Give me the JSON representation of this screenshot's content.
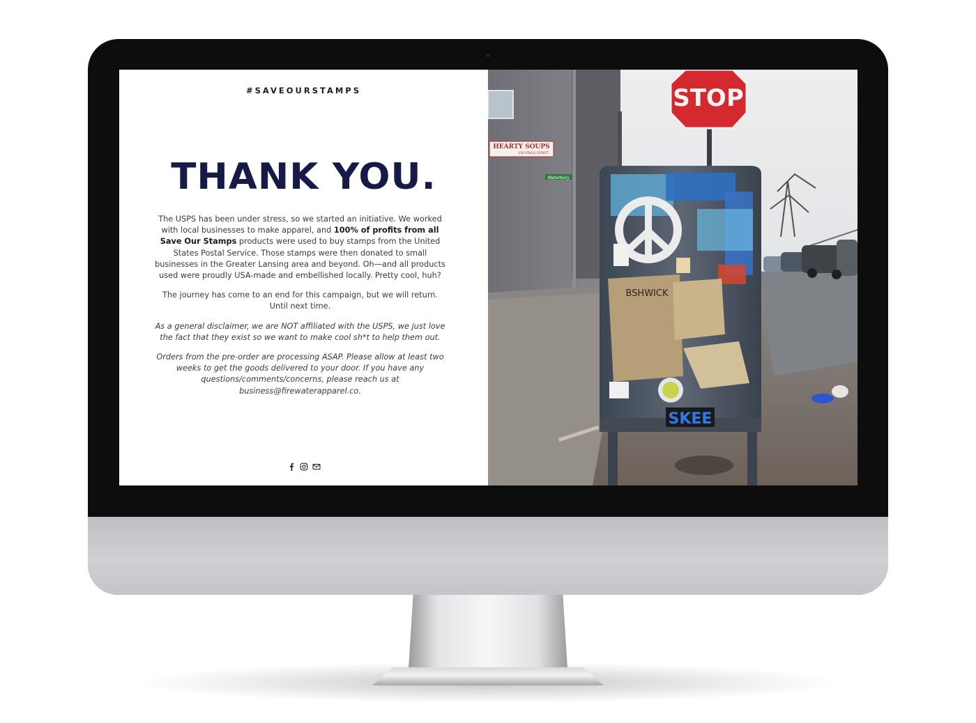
{
  "page": {
    "hashtag": "#SAVEOURSTAMPS",
    "headline": "THANK YOU.",
    "para1_a": "The USPS has been under stress, so we started an initiative. We worked with local businesses to make apparel, and ",
    "para1_bold": "100% of profits from all Save Our Stamps",
    "para1_b": " products were used to buy stamps from the United States Postal Service. Those stamps were then donated to small businesses in the Greater Lansing area and beyond. Oh—and all products used were proudly USA-made and embellished locally. Pretty cool, huh?",
    "para2": "The journey has come to an end for this campaign, but we will return. Until next time.",
    "para3": "As a general disclaimer, we are NOT affiliated with the USPS, we just love the fact that they exist so we want to make cool sh*t to help them out.",
    "para4": "Orders from the pre-order are processing ASAP. Please allow at least two weeks to get the goods delivered to your door. If you have any questions/comments/concerns, please reach us at business@firewaterapparel.co."
  },
  "socials": [
    {
      "icon": "facebook-icon"
    },
    {
      "icon": "instagram-icon"
    },
    {
      "icon": "mail-icon"
    }
  ],
  "photo": {
    "stop_sign": "STOP",
    "store_sign": "HEARTY SOUPS",
    "store_address": "276 STAGG STREET",
    "street_sign": "Waterbury",
    "sticker_text": "SKEE",
    "box_tag": "BSHWICK"
  },
  "colors": {
    "headline": "#161a46",
    "stop_red": "#d42a2f",
    "bezel": "#0d0d0e",
    "chin": "#c8c9cc"
  }
}
